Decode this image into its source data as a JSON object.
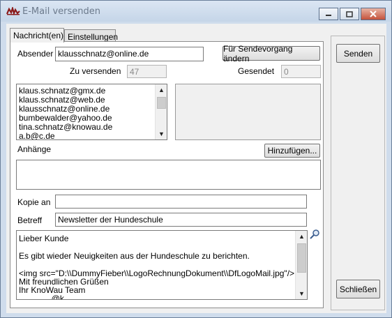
{
  "window": {
    "title": "E-Mail versenden",
    "icon": "app-logo-icon",
    "controls": [
      "minimize-icon",
      "maximize-icon",
      "close-icon"
    ]
  },
  "tabs": [
    {
      "label": "Nachricht(en)",
      "active": true
    },
    {
      "label": "Einstellungen",
      "active": false
    }
  ],
  "sender": {
    "label": "Absender",
    "value": "klausschnatz@online.de",
    "change_button": "Für Sendevorgang ändern"
  },
  "counts": {
    "to_send_label": "Zu versenden",
    "to_send_value": "47",
    "sent_label": "Gesendet",
    "sent_value": "0"
  },
  "recipients": [
    "klaus.schnatz@gmx.de",
    "klaus.schnatz@web.de",
    "klausschnatz@online.de",
    "bumbewalder@yahoo.de",
    "tina.schnatz@knowau.de",
    "a.b@c.de"
  ],
  "attachments": {
    "label": "Anhänge",
    "add_button": "Hinzufügen..."
  },
  "cc": {
    "label": "Kopie an",
    "value": ""
  },
  "subject": {
    "label": "Betreff",
    "value": "Newsletter der Hundeschule"
  },
  "message": {
    "lines": [
      "Lieber Kunde",
      "",
      "Es gibt wieder Neuigkeiten aus der Hundeschule zu berichten.",
      "",
      "<img src=\"D:\\\\DummyFieber\\\\LogoRechnungDokument\\\\DfLogoMail.jpg\"/>",
      "Mit freundlichen Grüßen",
      "Ihr KnoWau Team",
      "..............@k............"
    ],
    "zoom_icon": "magnifier-icon"
  },
  "actions": {
    "send": "Senden",
    "close": "Schließen"
  }
}
